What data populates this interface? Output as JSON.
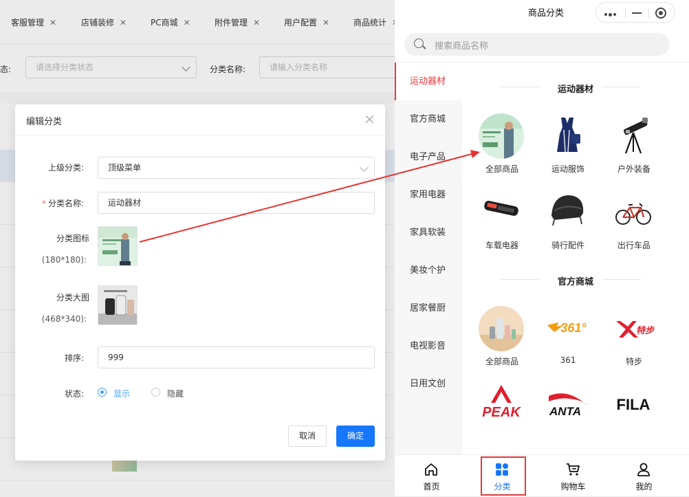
{
  "admin": {
    "tabs": [
      "客服管理",
      "店铺装修",
      "PC商城",
      "附件管理",
      "用户配置",
      "商品统计"
    ],
    "tab_close": "✕",
    "filter": {
      "status_label_partial": "态:",
      "status_placeholder": "请选择分类状态",
      "name_label": "分类名称:",
      "name_placeholder": "请输入分类名称"
    }
  },
  "modal": {
    "title": "编辑分类",
    "parent_label": "上级分类:",
    "parent_value": "顶级菜单",
    "name_label": "分类名称:",
    "required_mark": "*",
    "name_value": "运动器材",
    "icon_label": "分类图标",
    "icon_size": "(180*180):",
    "banner_label": "分类大图",
    "banner_size": "(468*340):",
    "sort_label": "排序:",
    "sort_value": "999",
    "status_label": "状态:",
    "status_options": [
      "显示",
      "隐藏"
    ],
    "status_selected": "显示",
    "cancel": "取消",
    "confirm": "确定"
  },
  "phone": {
    "title": "商品分类",
    "search_placeholder": "搜索商品名称",
    "sidebar": [
      "运动器材",
      "官方商城",
      "电子产品",
      "家用电器",
      "家具软装",
      "美妆个护",
      "居家餐厨",
      "电视影音",
      "日用文创"
    ],
    "sidebar_active": "运动器材",
    "sections": [
      {
        "title": "运动器材",
        "items": [
          {
            "label": "全部商品",
            "icon": "all-products-image"
          },
          {
            "label": "运动服饰",
            "icon": "sportswear-dress-image"
          },
          {
            "label": "户外装备",
            "icon": "telescope-image"
          },
          {
            "label": "车载电器",
            "icon": "dash-cam-mirror-image"
          },
          {
            "label": "骑行配件",
            "icon": "cycling-helmet-image"
          },
          {
            "label": "出行车品",
            "icon": "bicycle-image"
          }
        ]
      },
      {
        "title": "官方商城",
        "items": [
          {
            "label": "全部商品",
            "icon": "all-products-store-image"
          },
          {
            "label": "361",
            "icon": "361-logo",
            "logo_text": "361°"
          },
          {
            "label": "特步",
            "icon": "xtep-logo",
            "logo_text": "特步"
          },
          {
            "label": "",
            "icon": "peak-logo",
            "logo_text": "PEAK"
          },
          {
            "label": "",
            "icon": "anta-logo",
            "logo_text": "ANTA"
          },
          {
            "label": "",
            "icon": "fila-logo",
            "logo_text": "FILA"
          }
        ]
      }
    ],
    "tabbar": [
      {
        "label": "首页",
        "icon": "home-icon"
      },
      {
        "label": "分类",
        "icon": "category-icon"
      },
      {
        "label": "购物车",
        "icon": "cart-icon"
      },
      {
        "label": "我的",
        "icon": "user-icon"
      }
    ],
    "tabbar_active": "分类"
  },
  "colors": {
    "accent_red": "#e4393c",
    "primary_blue": "#1677ff",
    "radio_blue": "#409eff"
  }
}
